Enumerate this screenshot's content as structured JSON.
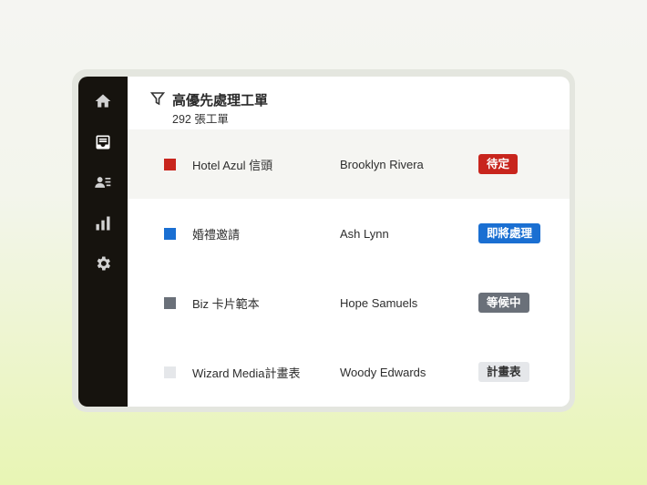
{
  "app": {
    "title": "高優先處理工單",
    "subtitle": "292 張工單"
  },
  "nav": [
    {
      "icon": "home-icon",
      "active": false
    },
    {
      "icon": "inbox-icon",
      "active": true
    },
    {
      "icon": "contacts-icon",
      "active": false
    },
    {
      "icon": "bar-chart-icon",
      "active": false
    },
    {
      "icon": "gear-icon",
      "active": false
    }
  ],
  "rows": [
    {
      "name": "Hotel Azul 信頭",
      "client": "Brooklyn Rivera",
      "status": "待定",
      "swatch": "#c8251d",
      "badge_bg": "#c8251d",
      "badge_fg": "#ffffff",
      "selected": true
    },
    {
      "name": "婚禮邀請",
      "client": "Ash Lynn",
      "status": "即將處理",
      "swatch": "#1a6fd2",
      "badge_bg": "#1a6fd2",
      "badge_fg": "#ffffff",
      "selected": false
    },
    {
      "name": "Biz 卡片範本",
      "client": "Hope Samuels",
      "status": "等候中",
      "swatch": "#6a7079",
      "badge_bg": "#6a7079",
      "badge_fg": "#ffffff",
      "selected": false
    },
    {
      "name": "Wizard Media計畫表",
      "client": "Woody Edwards",
      "status": "計畫表",
      "swatch": "#e5e7ea",
      "badge_bg": "#e5e7ea",
      "badge_fg": "#333333",
      "selected": false
    }
  ]
}
